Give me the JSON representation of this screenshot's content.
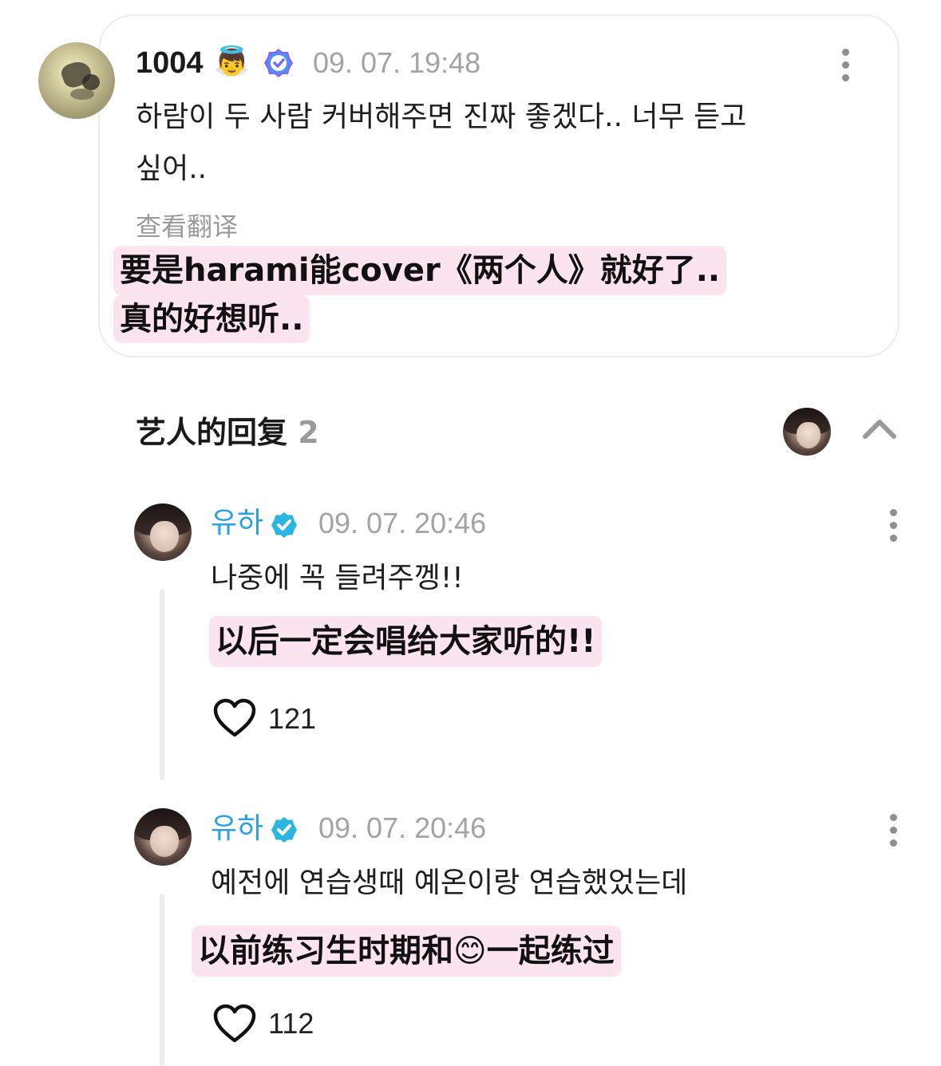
{
  "top_comment": {
    "username": "1004",
    "username_emoji": "👼",
    "verified_badge_color": "#8a63f5",
    "timestamp": "09. 07. 19:48",
    "text_line1": "하람이 두 사람 커버해주면 진짜 좋겠다.. 너무 듣고",
    "text_line2": "싶어..",
    "translate_link": "查看翻译",
    "translation_line1": "要是harami能cover《两个人》就好了..",
    "translation_line2": "真的好想听.."
  },
  "replies_section": {
    "title": "艺人的回复",
    "count": "2"
  },
  "replies": [
    {
      "username": "유하",
      "timestamp": "09. 07. 20:46",
      "text": "나중에 꼭 들려주껭!!",
      "translation": "以后一定会唱给大家听的!!",
      "likes": "121"
    },
    {
      "username": "유하",
      "timestamp": "09. 07. 20:46",
      "text": "예전에 연습생때 예온이랑 연습했었는데",
      "translation_before": "以前练习生时期和",
      "translation_emoji": "😊",
      "translation_after": "一起练过",
      "likes": "112"
    }
  ],
  "colors": {
    "artist_name": "#2aa0e6",
    "artist_badge": "#2bb5e0",
    "highlight": "#fbe3f0",
    "timestamp": "#a3a3a3"
  },
  "icons": {
    "more": "kebab-menu-icon",
    "collapse": "chevron-up-icon",
    "like": "heart-outline-icon",
    "verified": "verified-badge-icon"
  }
}
